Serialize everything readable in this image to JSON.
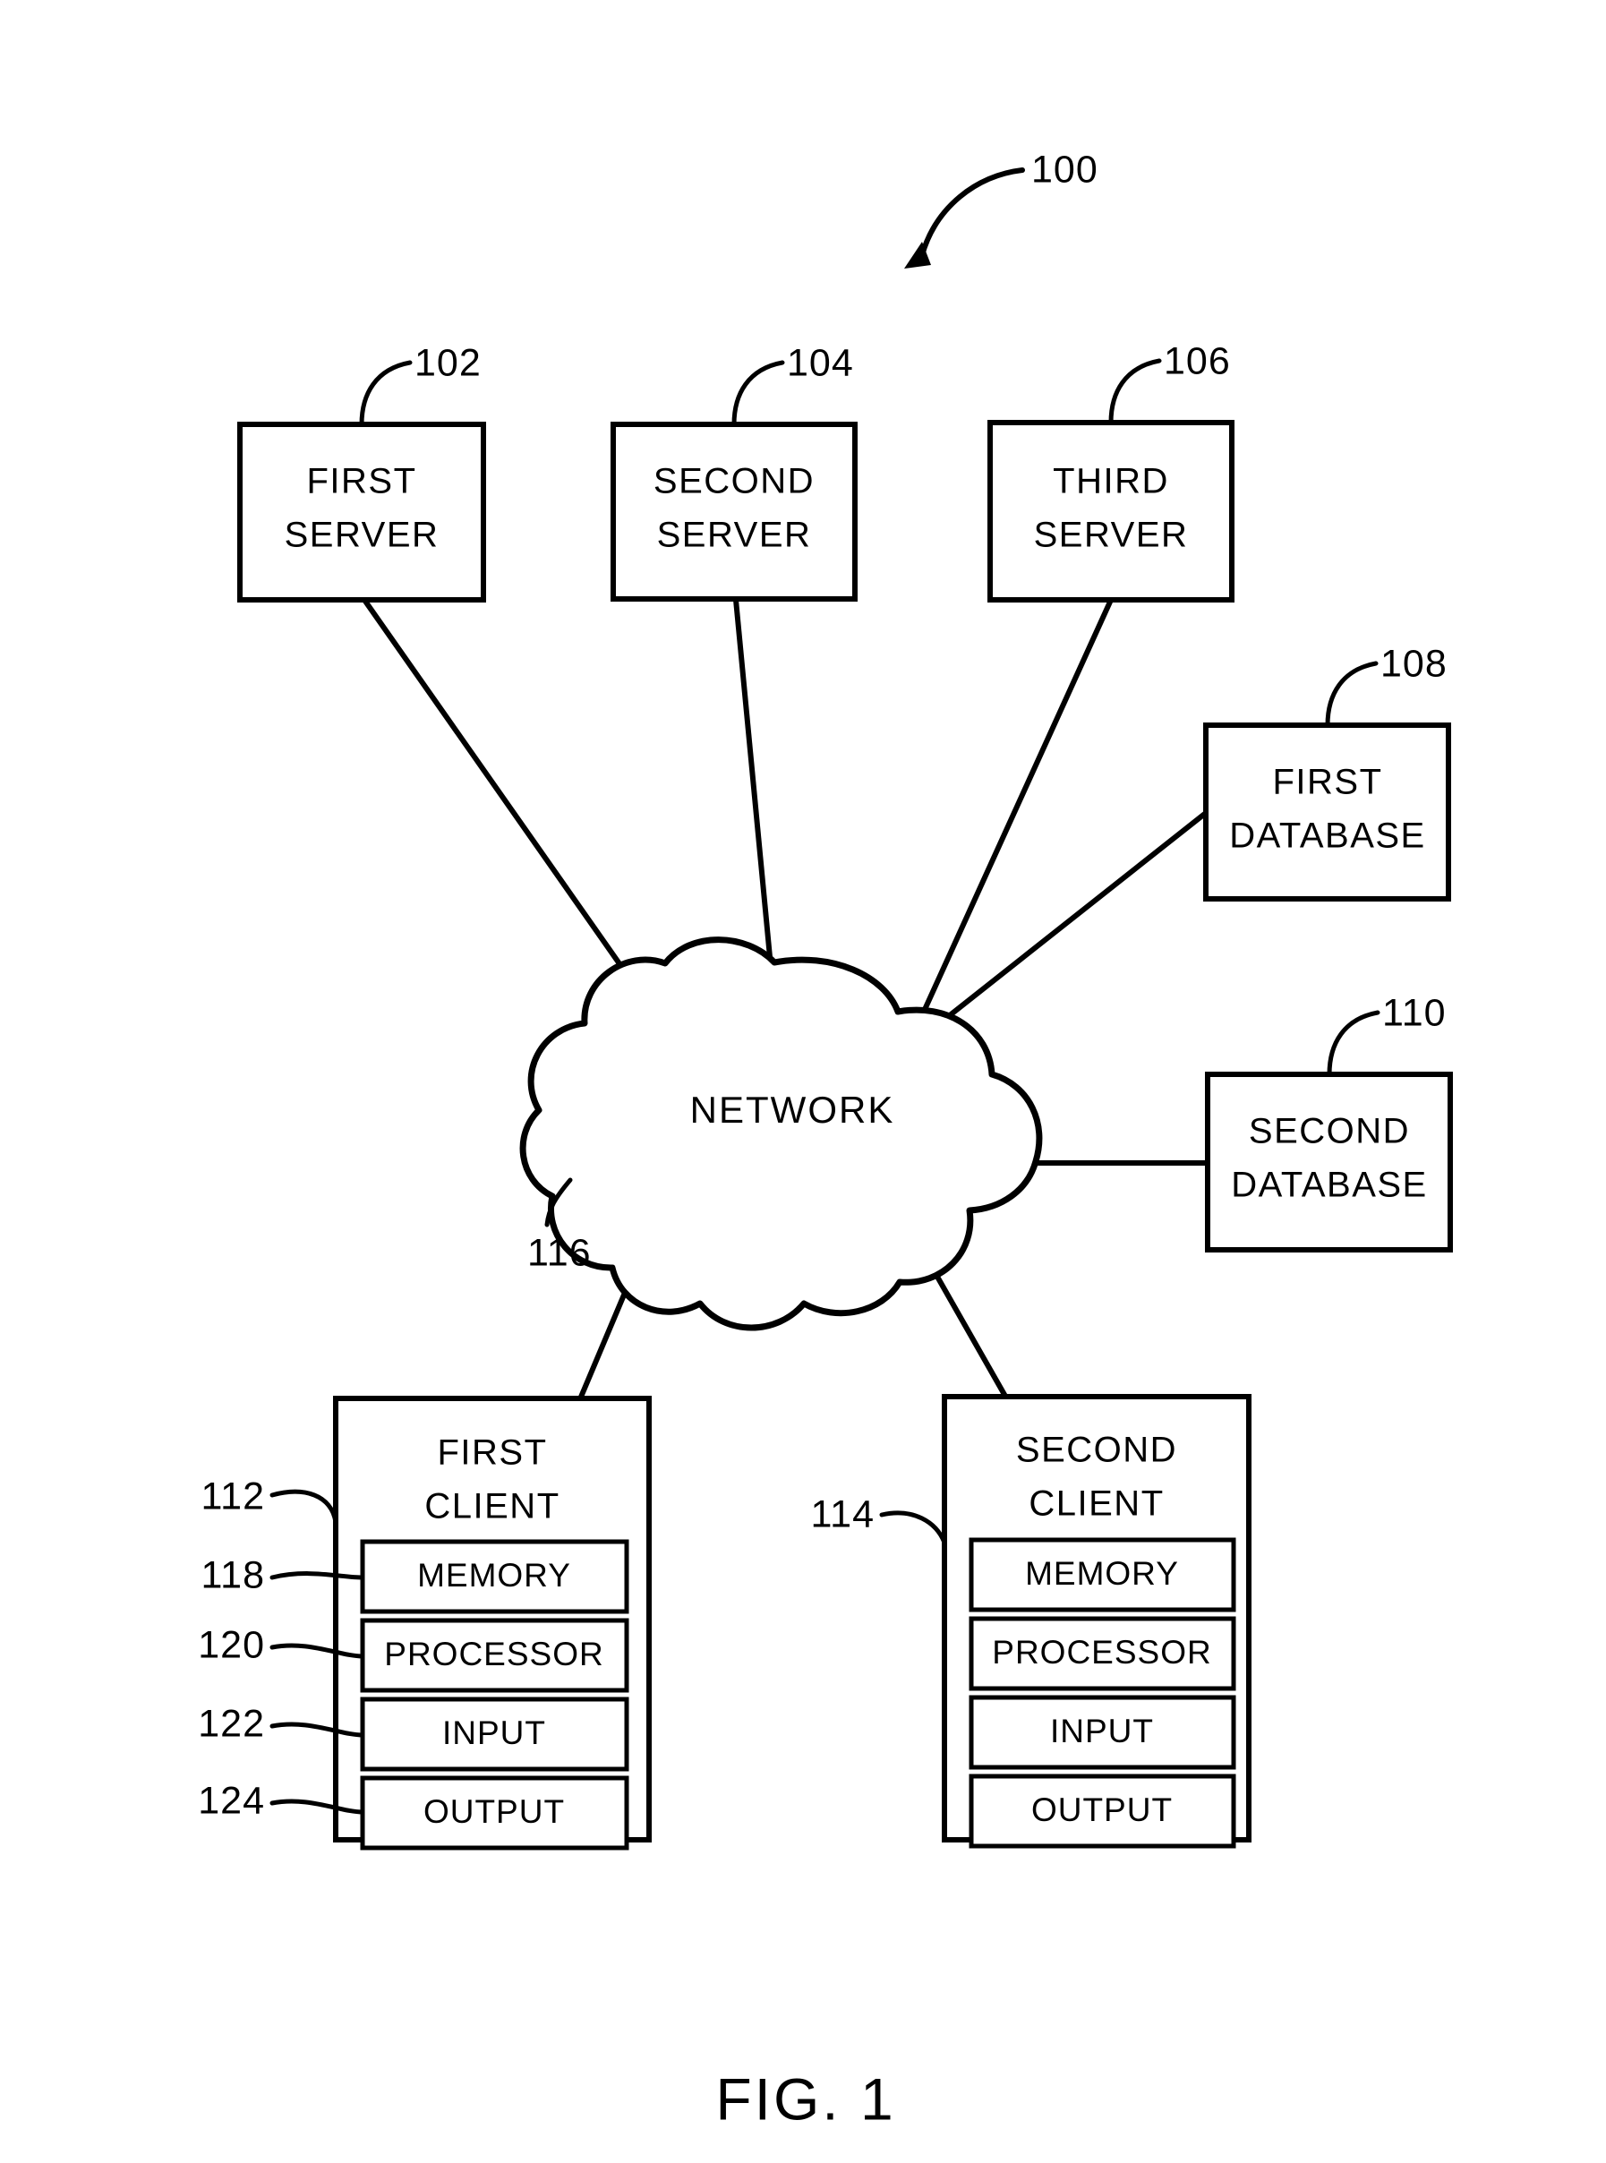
{
  "figure": {
    "caption": "FIG. 1",
    "system_ref": "100"
  },
  "nodes": {
    "first_server": {
      "line1": "FIRST",
      "line2": "SERVER",
      "ref": "102"
    },
    "second_server": {
      "line1": "SECOND",
      "line2": "SERVER",
      "ref": "104"
    },
    "third_server": {
      "line1": "THIRD",
      "line2": "SERVER",
      "ref": "106"
    },
    "first_database": {
      "line1": "FIRST",
      "line2": "DATABASE",
      "ref": "108"
    },
    "second_database": {
      "line1": "SECOND",
      "line2": "DATABASE",
      "ref": "110"
    },
    "network": {
      "label": "NETWORK",
      "ref": "116"
    },
    "first_client": {
      "line1": "FIRST",
      "line2": "CLIENT",
      "ref": "112"
    },
    "second_client": {
      "line1": "SECOND",
      "line2": "CLIENT",
      "ref": "114"
    }
  },
  "client_components": {
    "memory": {
      "label": "MEMORY",
      "ref": "118"
    },
    "processor": {
      "label": "PROCESSOR",
      "ref": "120"
    },
    "input": {
      "label": "INPUT",
      "ref": "122"
    },
    "output": {
      "label": "OUTPUT",
      "ref": "124"
    }
  },
  "colors": {
    "stroke": "#000000",
    "background": "#ffffff"
  }
}
